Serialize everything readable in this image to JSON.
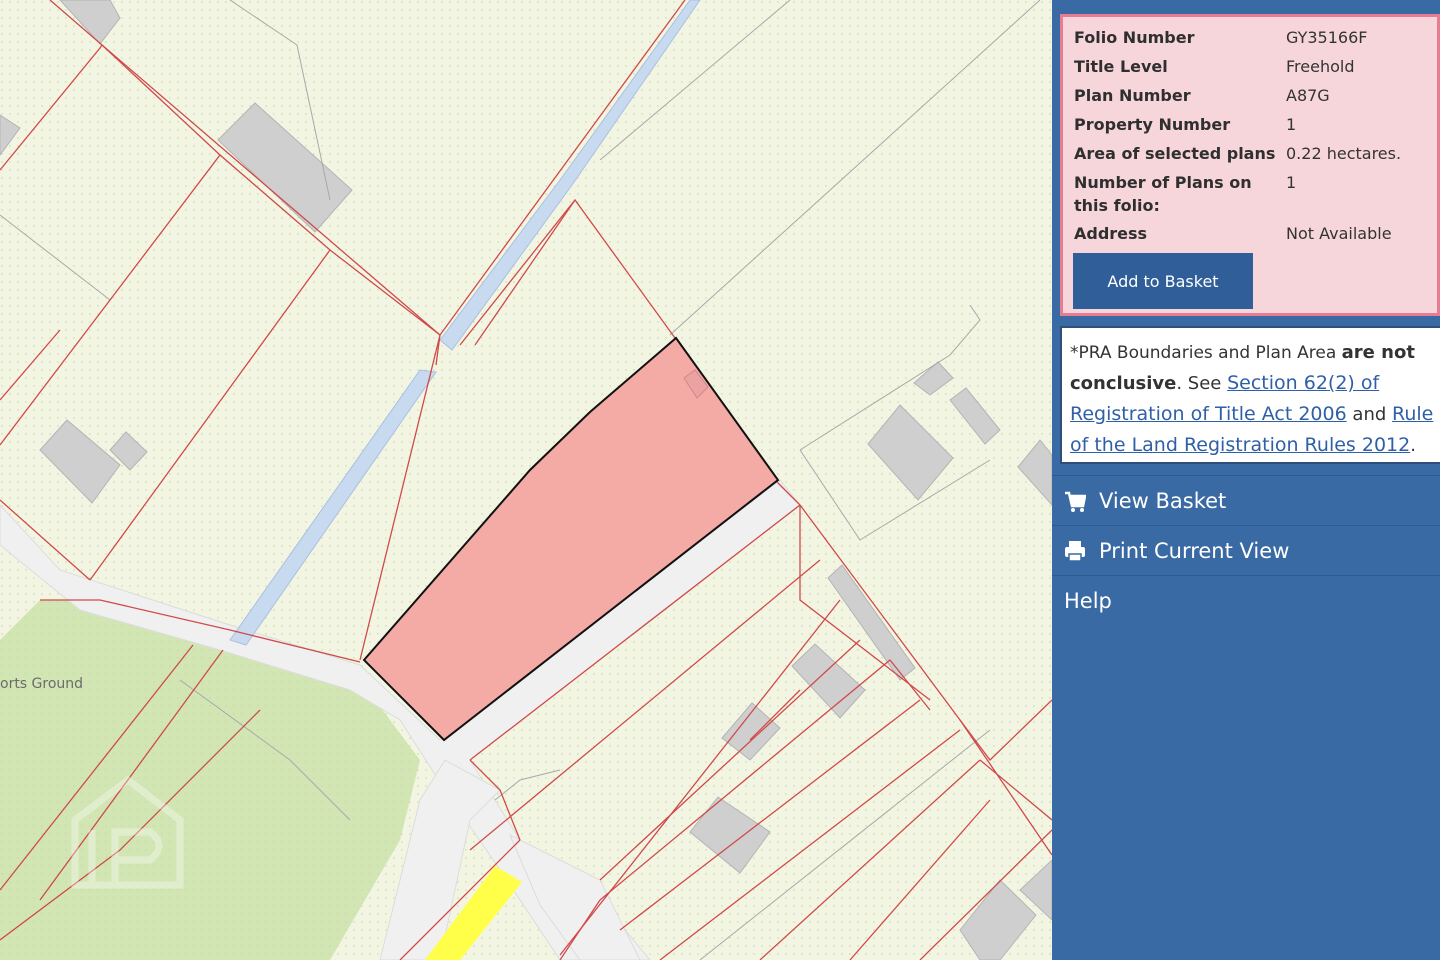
{
  "map": {
    "place_label": "orts Ground",
    "colors": {
      "background": "#f3f5e3",
      "parcel_line": "#d04a4a",
      "selected_parcel": "#f4aaa5",
      "road": "#f1f1f1",
      "building": "#cfcfcf",
      "field_green": "#d2e6b4",
      "stream": "#c8daf0",
      "highlight_road": "#ffff4a"
    }
  },
  "info": {
    "rows": [
      {
        "key": "Folio Number",
        "value": "GY35166F"
      },
      {
        "key": "Title Level",
        "value": "Freehold"
      },
      {
        "key": "Plan Number",
        "value": "A87G"
      },
      {
        "key": "Property Number",
        "value": "1"
      },
      {
        "key": "Area of selected plans",
        "value": "0.22 hectares."
      },
      {
        "key": "Number of Plans on this folio:",
        "value": "1"
      },
      {
        "key": "Address",
        "value": "Not Available"
      }
    ],
    "add_button": "Add to Basket"
  },
  "note": {
    "prefix": "*PRA Boundaries and Plan Area ",
    "bold": "are not conclusive",
    "see": ". See ",
    "link1": "Section 62(2) of Registration of Title Act 2006",
    "and": " and ",
    "link2": "Rule of the Land Registration Rules 2012",
    "end": "."
  },
  "nav": {
    "view_basket": "View Basket",
    "print_view": "Print Current View",
    "help": "Help"
  },
  "colors": {
    "panel": "#3a6aa4",
    "button": "#2f5e98",
    "info_bg": "#f7d6db",
    "info_border": "#e87c93",
    "link": "#2f5fa6"
  }
}
